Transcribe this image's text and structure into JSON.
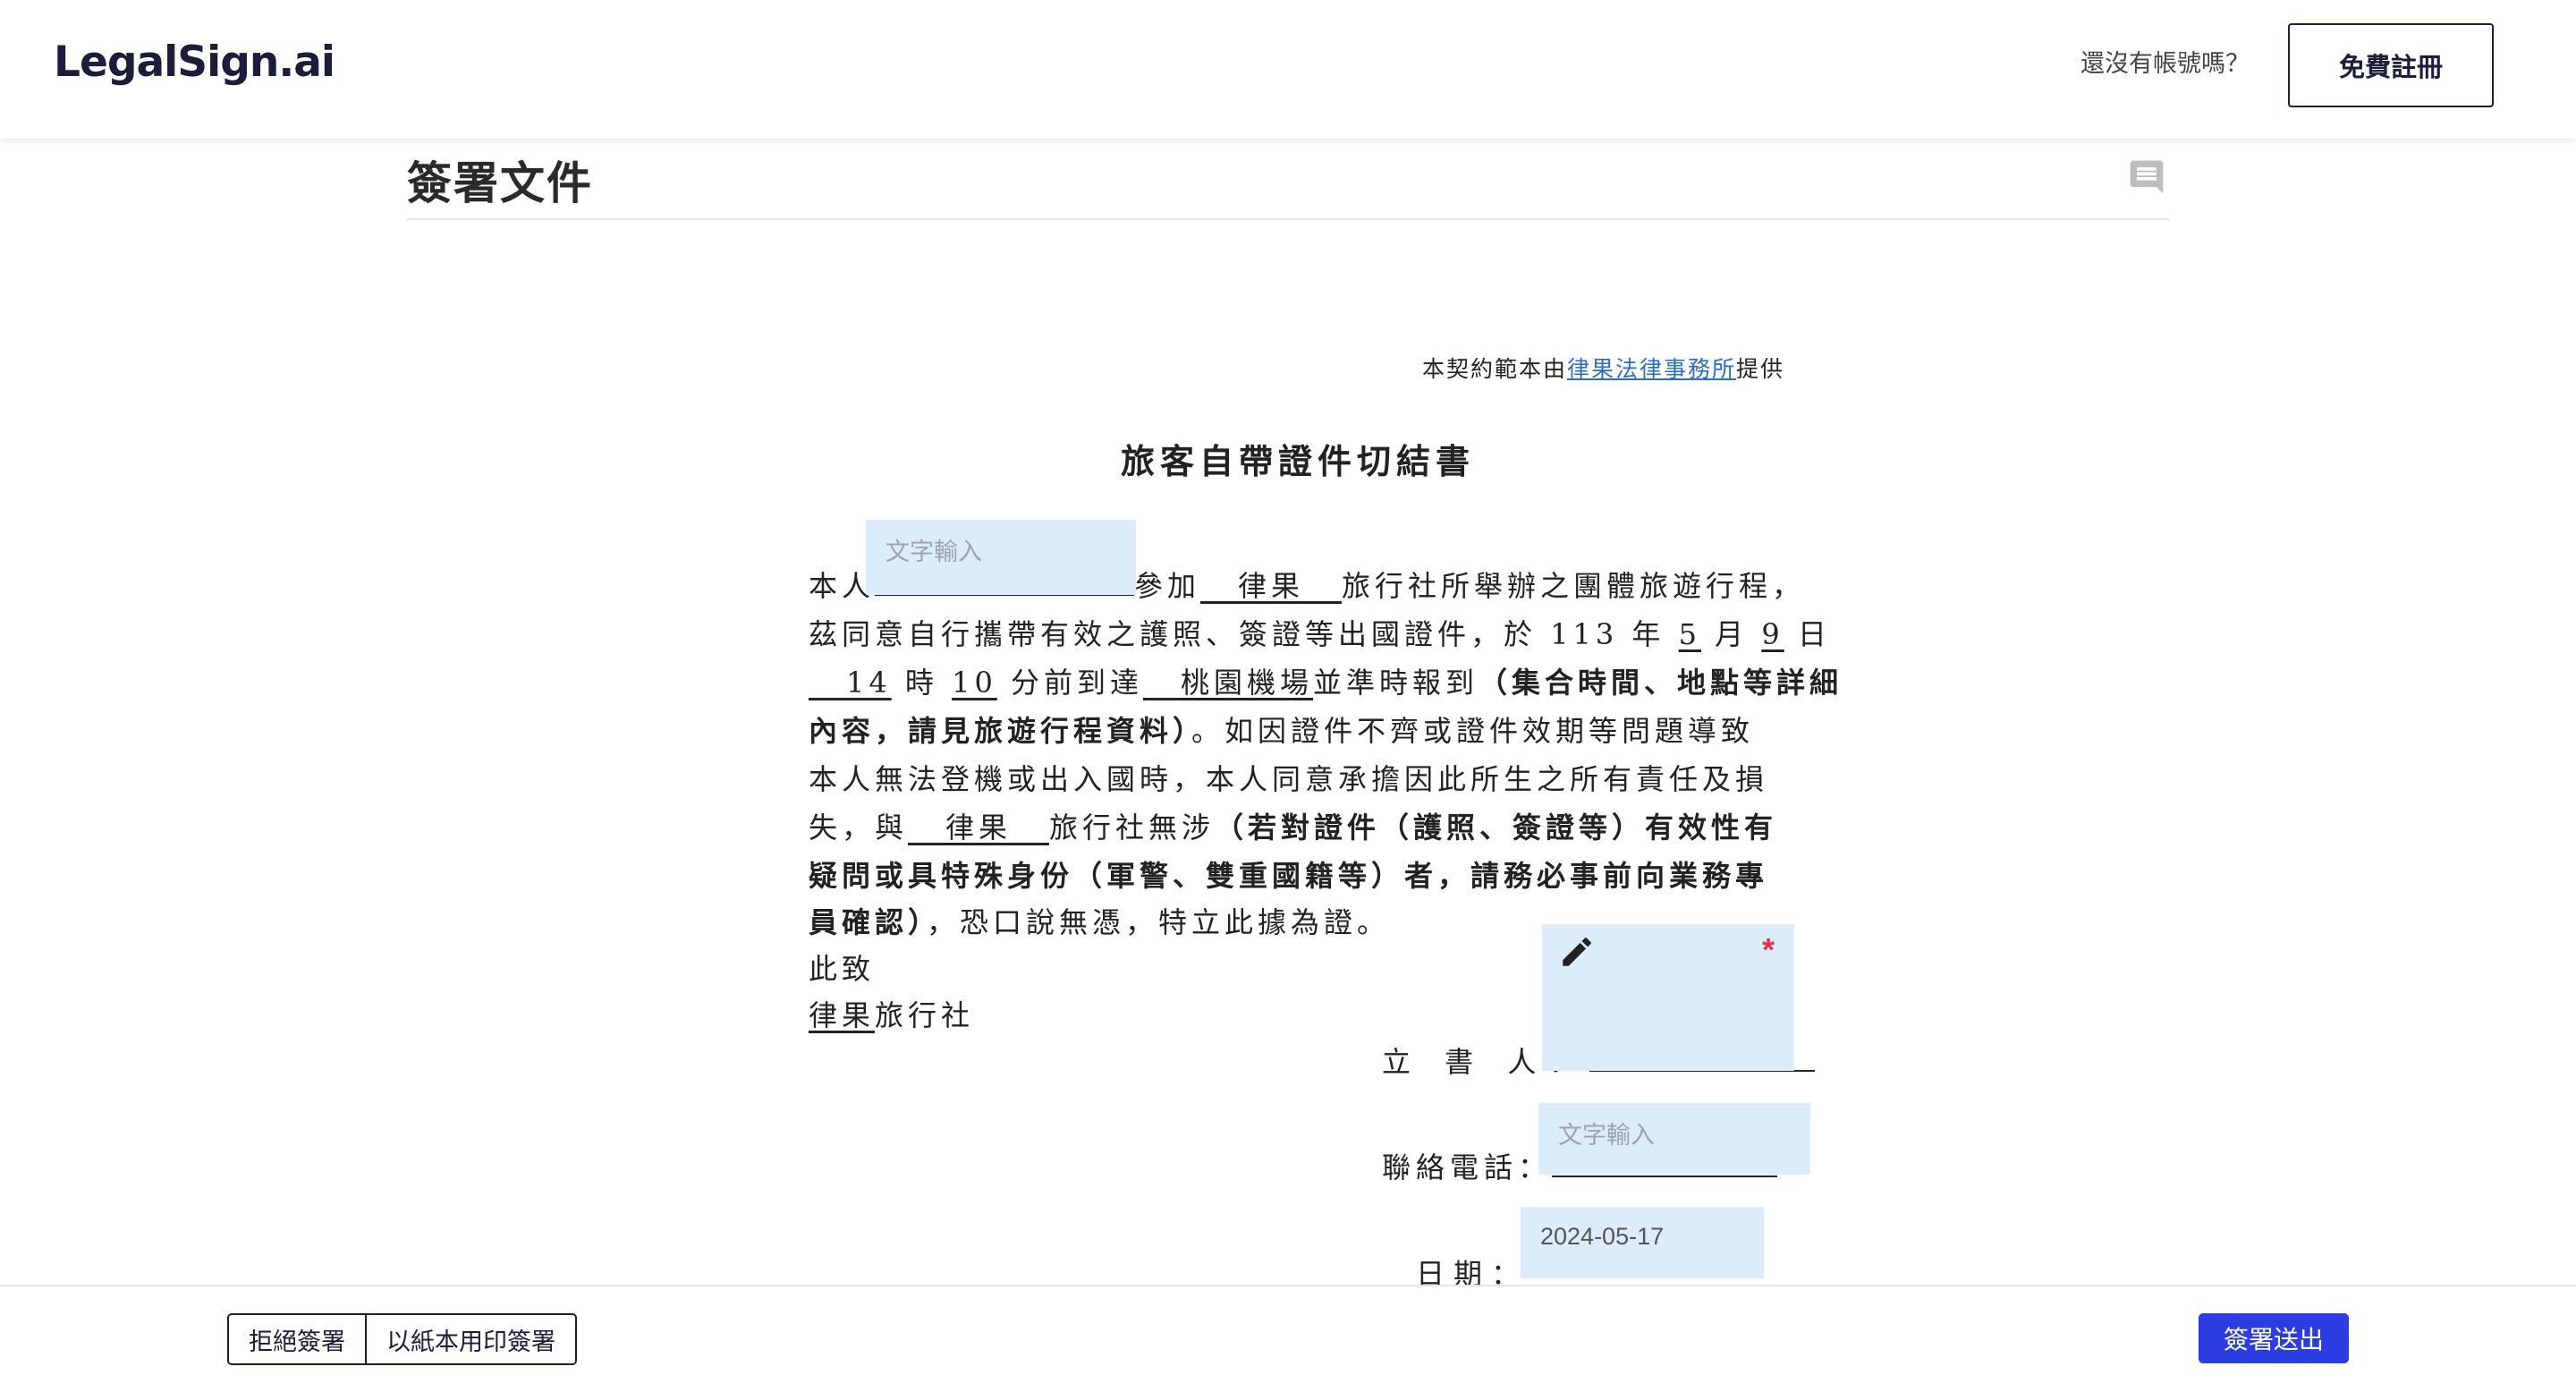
{
  "header": {
    "logo": "LegalSign.ai",
    "no_account_text": "還沒有帳號嗎？",
    "signup_label": "免費註冊"
  },
  "page": {
    "title": "簽署文件"
  },
  "document": {
    "provided_prefix": "本契約範本由",
    "provided_link": "律果法律事務所",
    "provided_suffix": "提供",
    "title": "旅客自帶證件切結書",
    "line1": {
      "a": "本人",
      "b": "參加",
      "c": "__律果__",
      "d": "旅行社所舉辦之團體旅遊行程，"
    },
    "line2": {
      "a": "茲同意自行攜帶有效之護照、簽證等出國證件，於 113 年 ",
      "month": "5",
      "b": " 月 ",
      "day": "9",
      "c": " 日"
    },
    "line3": {
      "hour": "__14",
      "a": " 時 ",
      "minute": "10",
      "b": " 分前到達",
      "place": "__桃園機場",
      "c": "並準時報到",
      "d": "（集合時間、地點等詳細"
    },
    "line4": {
      "a": "內容，請見旅遊行程資料）",
      "b": "。如因證件不齊或證件效期等問題導致"
    },
    "line5": "本人無法登機或出入國時，本人同意承擔因此所生之所有責任及損",
    "line6": {
      "a": "失，與",
      "b": "__律果__",
      "c": "旅行社無涉",
      "d": "（若對證件（護照、簽證等）有效性有"
    },
    "line7": "疑問或具特殊身份（軍警、雙重國籍等）者，請務必事前向業務專",
    "line8": {
      "a": "員確認）",
      "b": "，恐口說無憑，特立此據為證。"
    },
    "line9": "此致",
    "line10": {
      "a": "律果",
      "b": "旅行社"
    },
    "signer_label": "立 書 人：",
    "phone_label": "聯絡電話：",
    "date_label": "日期："
  },
  "fields": {
    "name_placeholder": "文字輸入",
    "phone_placeholder": "文字輸入",
    "date_value": "2024-05-17",
    "signature_required_mark": "*",
    "signature_icon": "pencil-icon"
  },
  "icons": {
    "comment": "comment-icon"
  },
  "footer": {
    "reject_label": "拒絕簽署",
    "paper_label": "以紙本用印簽署",
    "submit_label": "簽署送出"
  },
  "colors": {
    "brand_dark": "#1b1d3a",
    "primary": "#2b3de0",
    "field_bg": "#dcecfb",
    "link": "#2a6fc4",
    "required": "#e2324a"
  }
}
